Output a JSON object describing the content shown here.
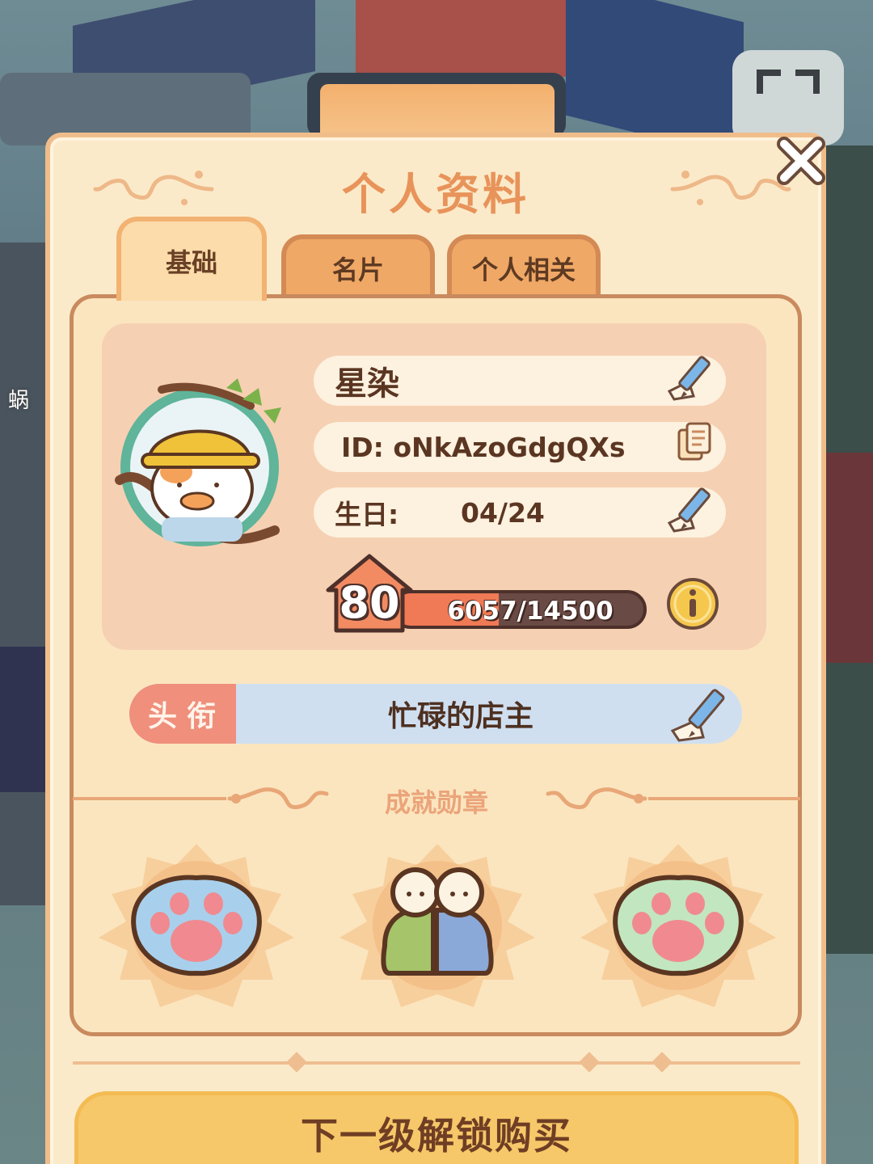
{
  "scene": {
    "side_label": "蜗"
  },
  "panel": {
    "title": "个人资料"
  },
  "tabs": [
    {
      "label": "基础",
      "active": true
    },
    {
      "label": "名片",
      "active": false
    },
    {
      "label": "个人相关",
      "active": false
    }
  ],
  "profile": {
    "name": "星染",
    "id": "ID: oNkAzoGdgQXs",
    "birthday_label": "生日:",
    "birthday_value": "04/24",
    "level": "80",
    "exp_text": "6057/14500",
    "exp_fraction": 0.4177
  },
  "title_field": {
    "tag": "头衔",
    "value": "忙碌的店主"
  },
  "achievements": {
    "heading": "成就勋章",
    "badges": [
      "paw-blue-icon",
      "twins-icon",
      "paw-green-icon"
    ]
  },
  "unlock": {
    "label": "下一级解锁购买"
  },
  "colors": {
    "panel_bg": "#fbeac9",
    "accent_orange": "#e8935a",
    "title_tag": "#ef8f7c",
    "unlock_bar": "#f7c869"
  }
}
